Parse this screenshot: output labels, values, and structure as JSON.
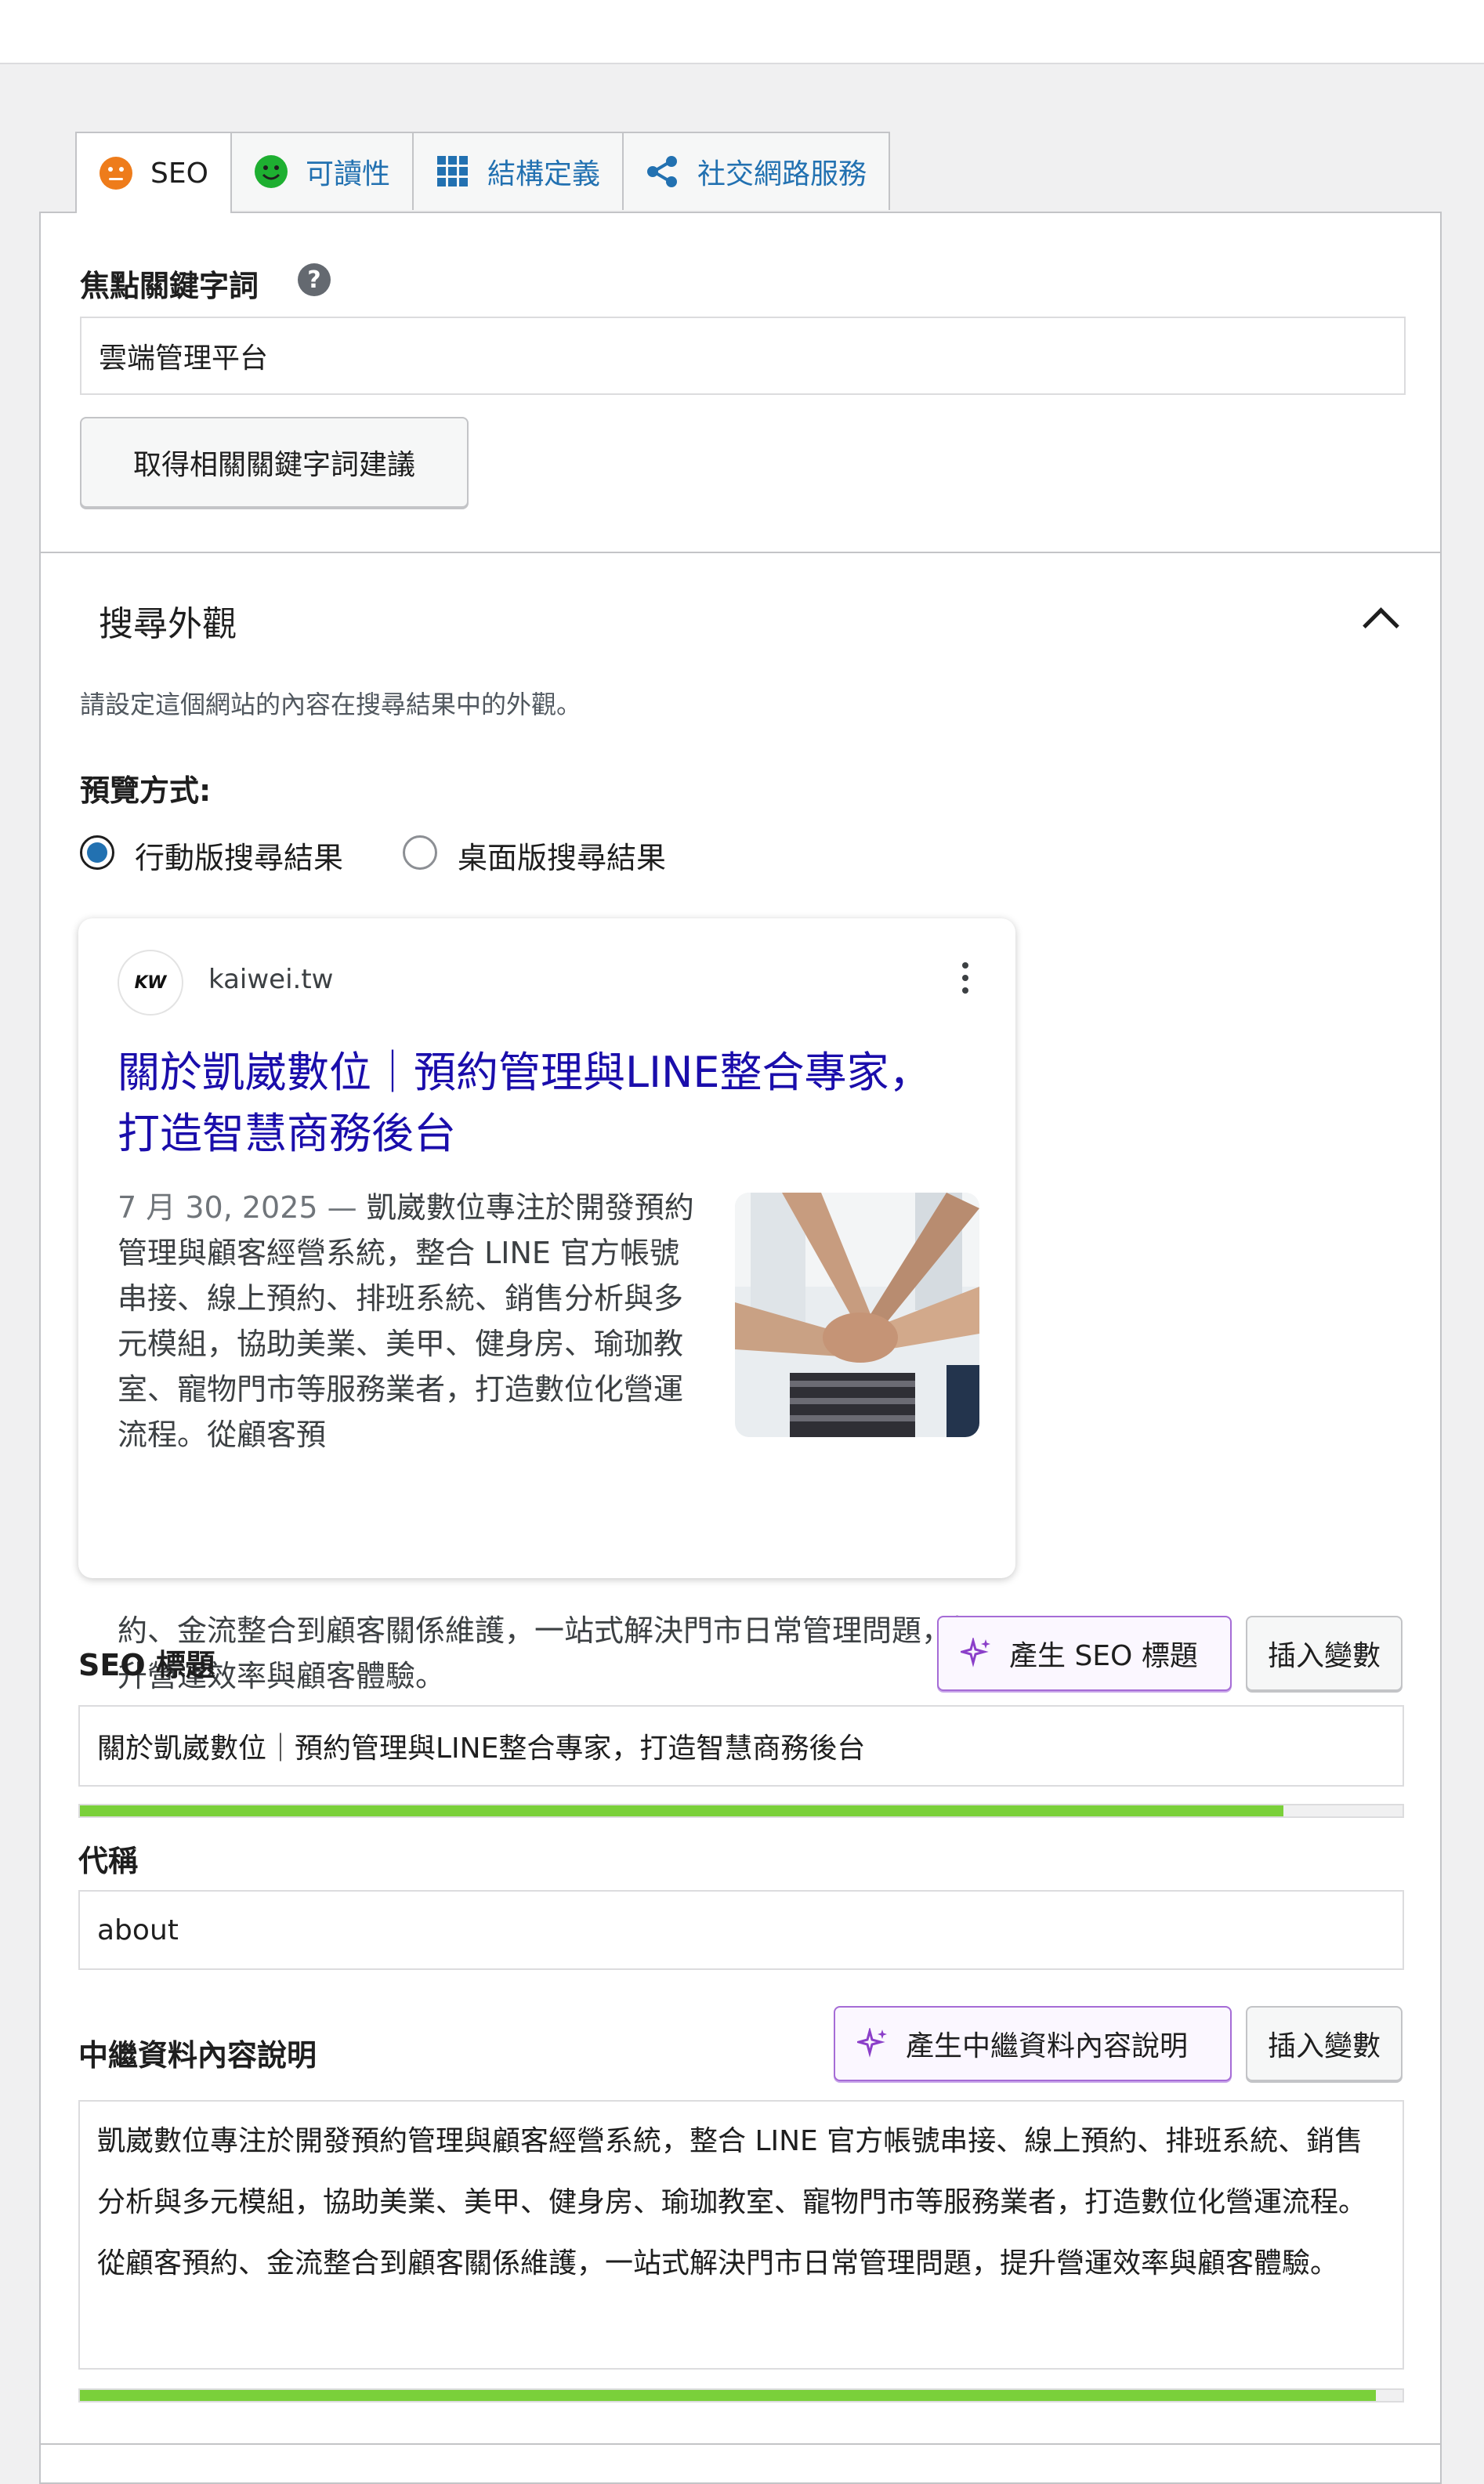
{
  "tabs": [
    {
      "label": "SEO",
      "icon": "seo-score-icon",
      "color": "#ee7c1b"
    },
    {
      "label": "可讀性",
      "icon": "readability-score-icon",
      "color": "#1eaf31"
    },
    {
      "label": "結構定義",
      "icon": "grid-icon",
      "color": "#2271b1"
    },
    {
      "label": "社交網路服務",
      "icon": "share-icon",
      "color": "#2271b1"
    }
  ],
  "focus_keyphrase": {
    "label": "焦點關鍵字詞",
    "help": "?",
    "value": "雲端管理平台",
    "related_button": "取得相關關鍵字詞建議"
  },
  "search_appearance": {
    "heading": "搜尋外觀",
    "description": "請設定這個網站的內容在搜尋結果中的外觀。",
    "preview_label": "預覽方式:",
    "options": [
      "行動版搜尋結果",
      "桌面版搜尋結果"
    ],
    "selected": "行動版搜尋結果"
  },
  "preview": {
    "favicon_text": "KW",
    "site": "kaiwei.tw",
    "title": "關於凱崴數位｜預約管理與LINE整合專家，打造智慧商務後台",
    "date": "7 月 30, 2025 —",
    "snippet_part1": "凱崴數位專注於開發預約管理與顧客經營系統，整合 LINE 官方帳號串接、線上預約、排班系統、銷售分析與多元模組，協助美業、美甲、健身房、瑜珈教室、寵物門市等服務業者，打造數位化營運流程。從顧客預",
    "snippet_part2": "約、金流整合到顧客關係維護，一站式解決門市日常管理問題，提升營運效率與顧客體驗。"
  },
  "seo_title": {
    "label": "SEO 標題",
    "ai_button": "產生 SEO 標題",
    "insert_button": "插入變數",
    "value": "關於凱崴數位｜預約管理與LINE整合專家，打造智慧商務後台",
    "progress": 0.91
  },
  "slug": {
    "label": "代稱",
    "value": "about"
  },
  "meta_description": {
    "label": "中繼資料內容說明",
    "ai_button": "產生中繼資料內容說明",
    "insert_button": "插入變數",
    "value": "凱崴數位專注於開發預約管理與顧客經營系統，整合 LINE 官方帳號串接、線上預約、排班系統、銷售分析與多元模組，協助美業、美甲、健身房、瑜珈教室、寵物門市等服務業者，打造數位化營運流程。從顧客預約、金流整合到顧客關係維護，一站式解決門市日常管理問題，提升營運效率與顧客體驗。",
    "progress": 0.98
  },
  "colors": {
    "link_blue": "#1a0dab",
    "accent": "#2271b1",
    "progress_green": "#7ad03a",
    "ai_purple": "#a56cd6"
  }
}
